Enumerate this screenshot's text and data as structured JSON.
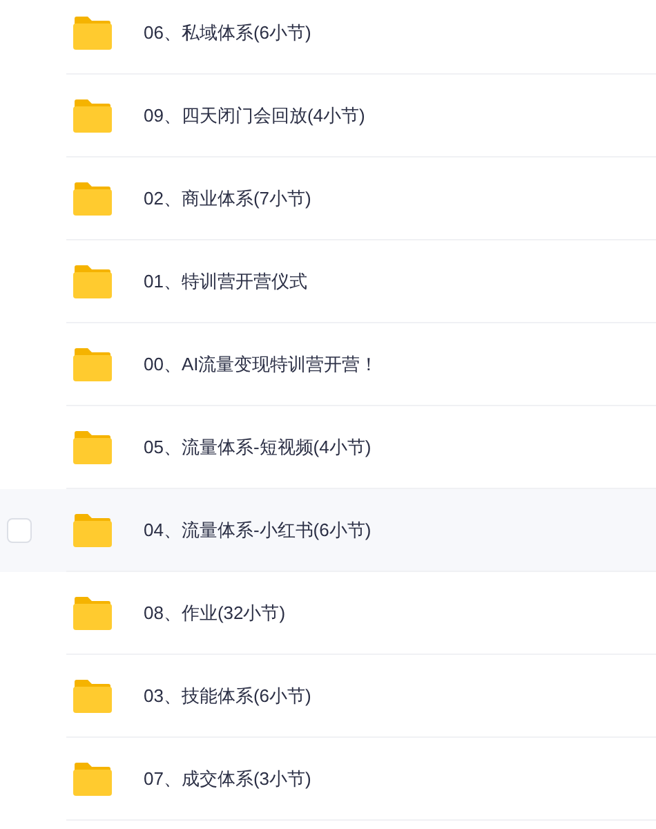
{
  "folders": [
    {
      "name": "06、私域体系(6小节)",
      "highlighted": false
    },
    {
      "name": "09、四天闭门会回放(4小节)",
      "highlighted": false
    },
    {
      "name": "02、商业体系(7小节)",
      "highlighted": false
    },
    {
      "name": "01、特训营开营仪式",
      "highlighted": false
    },
    {
      "name": "00、AI流量变现特训营开营！",
      "highlighted": false
    },
    {
      "name": "05、流量体系-短视频(4小节)",
      "highlighted": false
    },
    {
      "name": "04、流量体系-小红书(6小节)",
      "highlighted": true
    },
    {
      "name": "08、作业(32小节)",
      "highlighted": false
    },
    {
      "name": "03、技能体系(6小节)",
      "highlighted": false
    },
    {
      "name": "07、成交体系(3小节)",
      "highlighted": false
    }
  ]
}
